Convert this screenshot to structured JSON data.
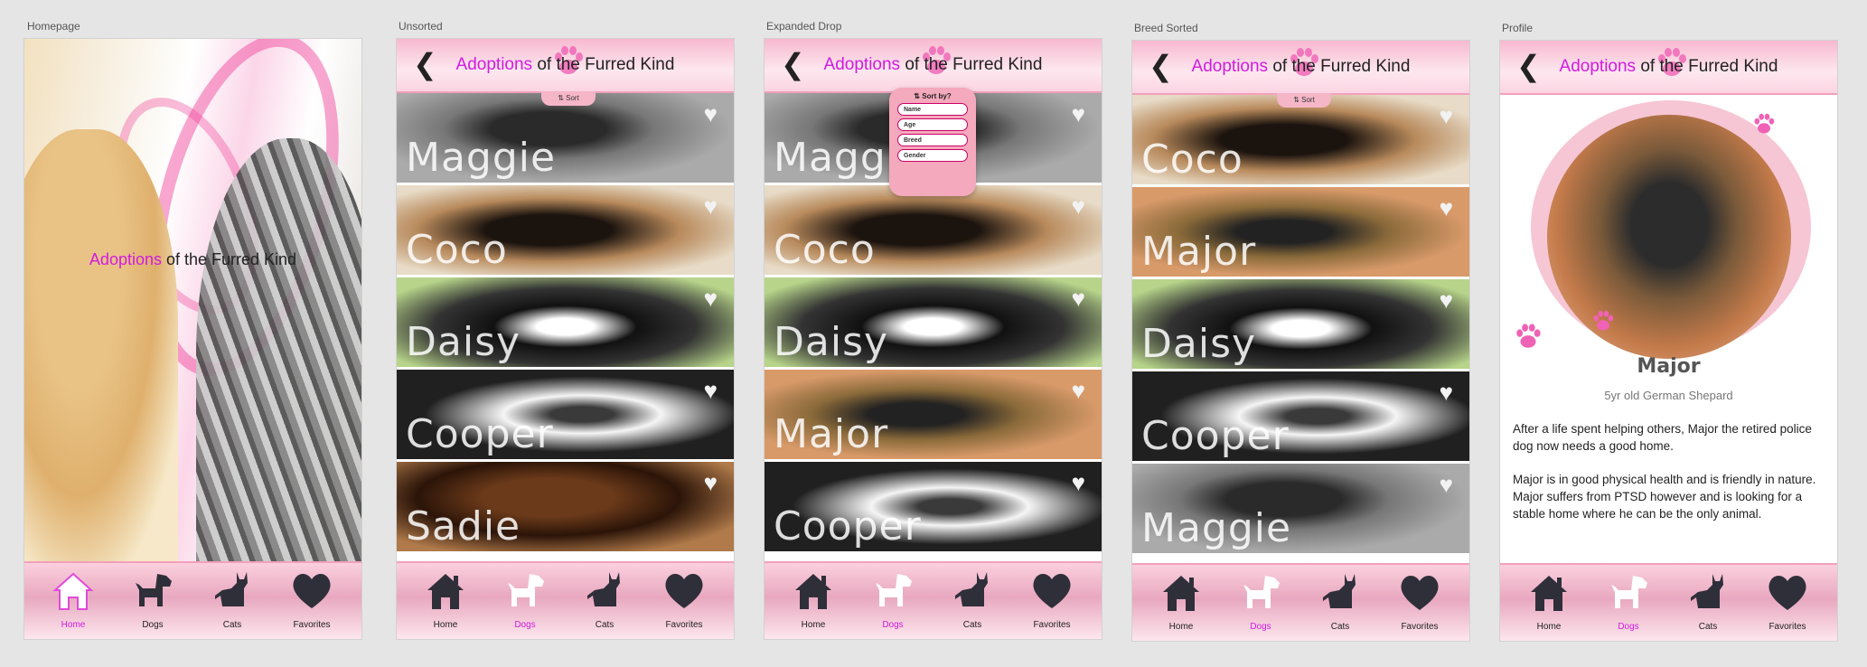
{
  "frames": [
    {
      "label": "Homepage"
    },
    {
      "label": "Unsorted"
    },
    {
      "label": "Expanded Drop"
    },
    {
      "label": "Breed Sorted"
    },
    {
      "label": "Profile"
    }
  ],
  "brand": {
    "title_accent": "Adoptions",
    "title_rest": " of the Furred Kind",
    "accent_color": "#d21be0"
  },
  "nav": {
    "home": "Home",
    "dogs": "Dogs",
    "cats": "Cats",
    "favorites": "Favorites"
  },
  "sort": {
    "tab_label": "Sort",
    "popup_title": "Sort by?",
    "options": [
      "Name",
      "Age",
      "Breed",
      "Gender"
    ]
  },
  "unsorted_list": [
    "Maggie",
    "Coco",
    "Daisy",
    "Cooper",
    "Sadie"
  ],
  "expanded_list": [
    "Maggie",
    "Coco",
    "Daisy",
    "Major",
    "Cooper"
  ],
  "breed_sorted_list": [
    "Coco",
    "Major",
    "Daisy",
    "Cooper",
    "Maggie"
  ],
  "profile": {
    "name": "Major",
    "subtitle": "5yr old German Shepard",
    "paragraph1": "After a life spent helping others, Major the retired police dog now needs a good home.",
    "paragraph2": "Major is in good physical health and is friendly in nature. Major suffers from PTSD however and is looking for a stable home where he can be the only animal."
  },
  "colors": {
    "pink": "#f5b6c8",
    "magenta": "#d21be0"
  }
}
